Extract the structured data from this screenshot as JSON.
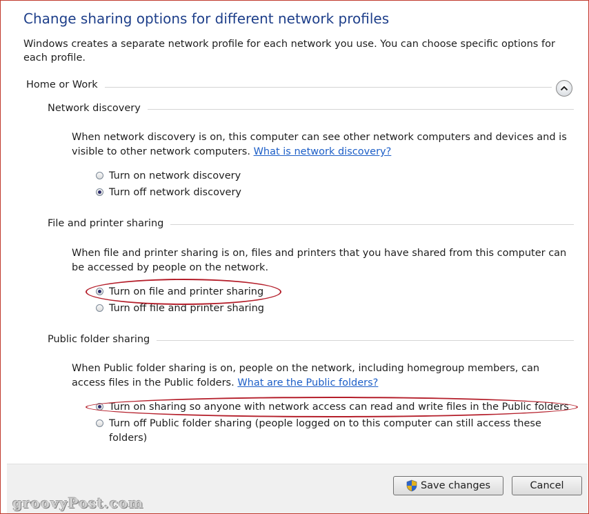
{
  "header": {
    "title": "Change sharing options for different network profiles",
    "description": "Windows creates a separate network profile for each network you use. You can choose specific options for each profile."
  },
  "profile": {
    "name": "Home or Work"
  },
  "network_discovery": {
    "heading": "Network discovery",
    "text": "When network discovery is on, this computer can see other network computers and devices and is visible to other network computers. ",
    "link": "What is network discovery?",
    "options": [
      {
        "label": "Turn on network discovery",
        "selected": false
      },
      {
        "label": "Turn off network discovery",
        "selected": true
      }
    ]
  },
  "file_sharing": {
    "heading": "File and printer sharing",
    "text": "When file and printer sharing is on, files and printers that you have shared from this computer can be accessed by people on the network.",
    "options": [
      {
        "label": "Turn on file and printer sharing",
        "selected": true
      },
      {
        "label": "Turn off file and printer sharing",
        "selected": false
      }
    ]
  },
  "public_sharing": {
    "heading": "Public folder sharing",
    "text": "When Public folder sharing is on, people on the network, including homegroup members, can access files in the Public folders. ",
    "link": "What are the Public folders?",
    "options": [
      {
        "label": "Turn on sharing so anyone with network access can read and write files in the Public folders",
        "selected": true
      },
      {
        "label": "Turn off Public folder sharing (people logged on to this computer can still access these",
        "label_cont": "folders)",
        "selected": false
      }
    ]
  },
  "footer": {
    "save_label": "Save changes",
    "cancel_label": "Cancel"
  },
  "watermark": "groovyPost.com",
  "colors": {
    "title": "#1e3f8a",
    "link": "#1c5ec7",
    "highlight_oval": "#b41e2a"
  }
}
